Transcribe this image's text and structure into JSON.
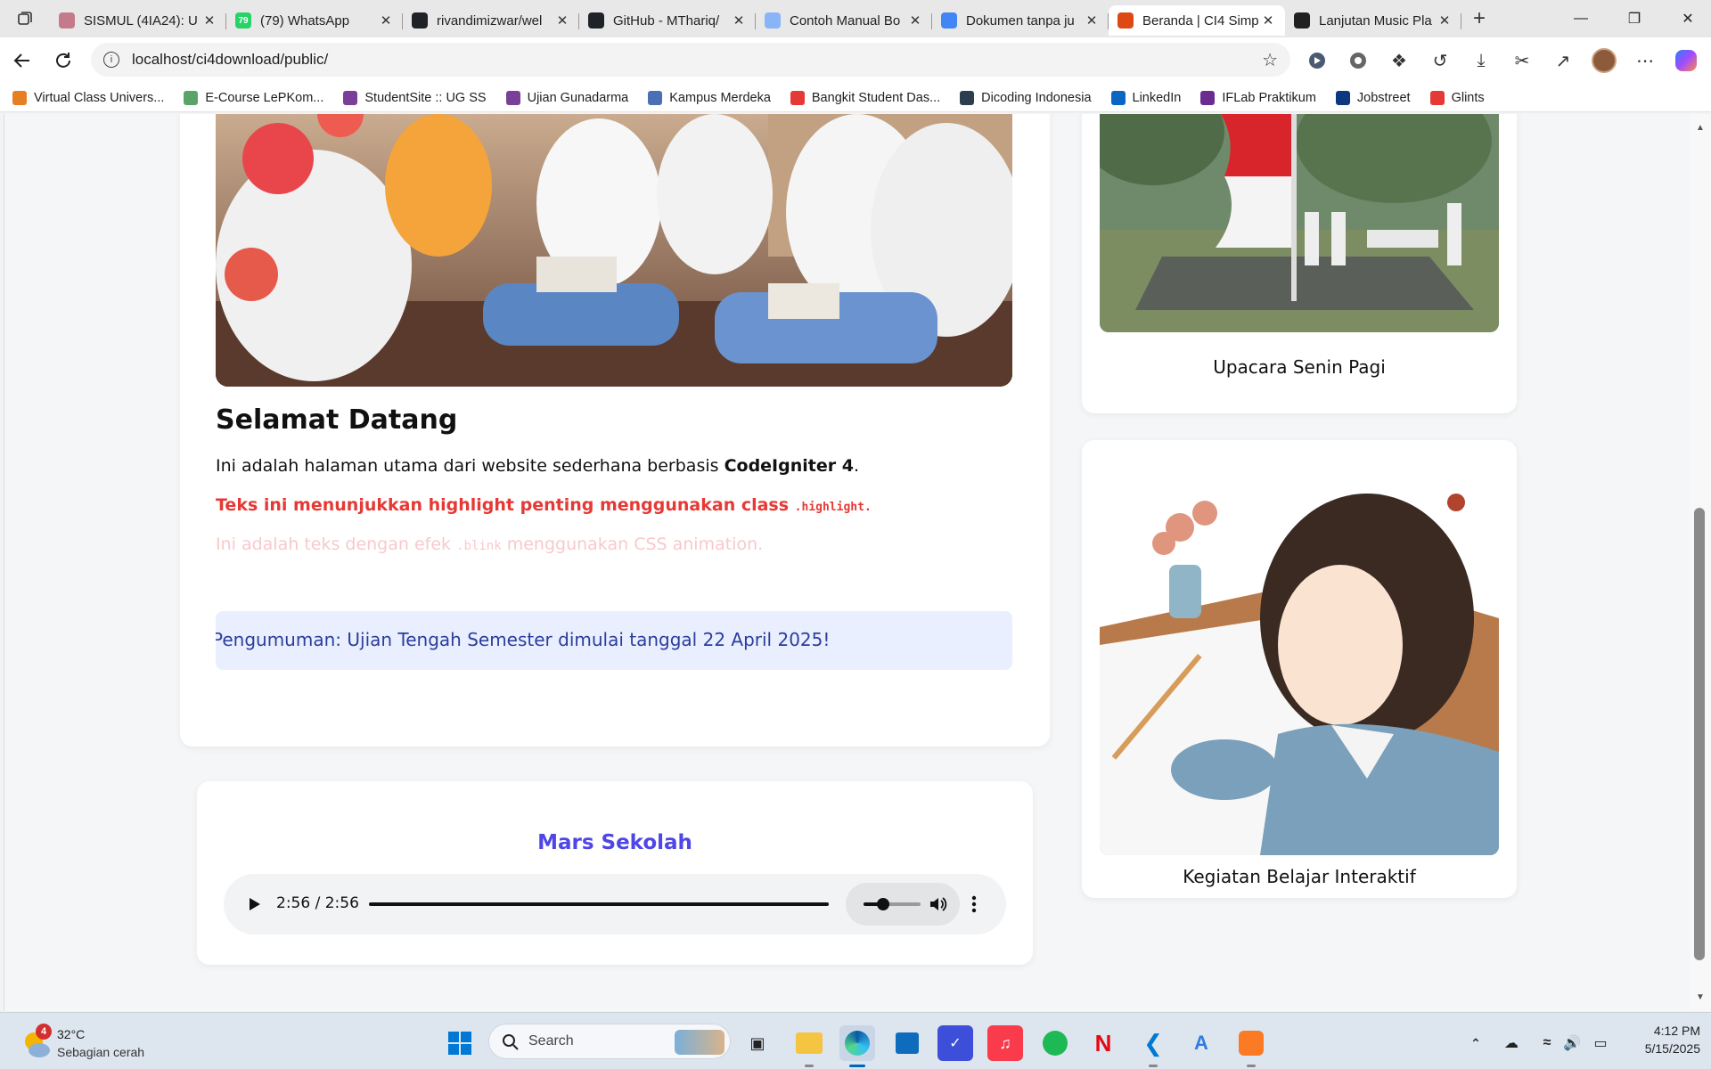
{
  "browser": {
    "tabs": [
      {
        "title": "SISMUL (4IA24): U",
        "fav_color": "#c47a8a",
        "fav_char": ""
      },
      {
        "title": "(79) WhatsApp",
        "fav_color": "#25d366",
        "fav_char": "79"
      },
      {
        "title": "rivandimizwar/wel",
        "fav_color": "#1f2328",
        "fav_char": ""
      },
      {
        "title": "GitHub - MThariq/",
        "fav_color": "#1f2328",
        "fav_char": ""
      },
      {
        "title": "Contoh Manual Bo",
        "fav_color": "#8ab4f8",
        "fav_char": ""
      },
      {
        "title": "Dokumen tanpa ju",
        "fav_color": "#4285f4",
        "fav_char": ""
      },
      {
        "title": "Beranda | CI4 Simp",
        "fav_color": "#dd4814",
        "fav_char": ""
      },
      {
        "title": "Lanjutan Music Pla",
        "fav_color": "#202020",
        "fav_char": ""
      }
    ],
    "active_tab": 6,
    "url": "localhost/ci4download/public/",
    "bookmarks": [
      {
        "label": "Virtual Class Univers...",
        "color": "#e67e22"
      },
      {
        "label": "E-Course LePKom...",
        "color": "#5aa469"
      },
      {
        "label": "StudentSite :: UG SS",
        "color": "#7a3f98"
      },
      {
        "label": "Ujian Gunadarma",
        "color": "#7a3f98"
      },
      {
        "label": "Kampus Merdeka",
        "color": "#4a6fb5"
      },
      {
        "label": "Bangkit Student Das...",
        "color": "#e53935"
      },
      {
        "label": "Dicoding Indonesia",
        "color": "#2d3e50"
      },
      {
        "label": "LinkedIn",
        "color": "#0a66c2"
      },
      {
        "label": "IFLab Praktikum",
        "color": "#6b2c91"
      },
      {
        "label": "Jobstreet",
        "color": "#0d3880"
      },
      {
        "label": "Glints",
        "color": "#e53935"
      }
    ]
  },
  "page": {
    "welcome_title": "Selamat Datang",
    "intro_prefix": "Ini adalah halaman utama dari website sederhana berbasis ",
    "intro_bold": "CodeIgniter 4",
    "intro_suffix": ".",
    "highlight_text": "Teks ini menunjukkan highlight penting menggunakan class ",
    "highlight_code": ".highlight.",
    "blink_prefix": "Ini adalah teks dengan efek ",
    "blink_code": ".blink",
    "blink_suffix": " menggunakan CSS animation.",
    "announcement": "Pengumuman: Ujian Tengah Semester dimulai tanggal 22 April 2025!",
    "audio": {
      "title": "Mars Sekolah",
      "time": "2:56 / 2:56",
      "progress": 1.0,
      "volume": 0.35
    },
    "gallery": [
      {
        "caption": "Upacara Senin Pagi"
      },
      {
        "caption": "Kegiatan Belajar Interaktif"
      }
    ],
    "colors": {
      "highlight": "#e53935",
      "blink": "#f8c9cc",
      "announcement_bg": "#e9efff",
      "announcement_text": "#2b3d9b",
      "audio_title": "#4f46e5"
    }
  },
  "taskbar": {
    "weather_temp": "32°C",
    "weather_desc": "Sebagian cerah",
    "weather_badge": "4",
    "search_placeholder": "Search",
    "time": "4:12 PM",
    "date": "5/15/2025"
  }
}
